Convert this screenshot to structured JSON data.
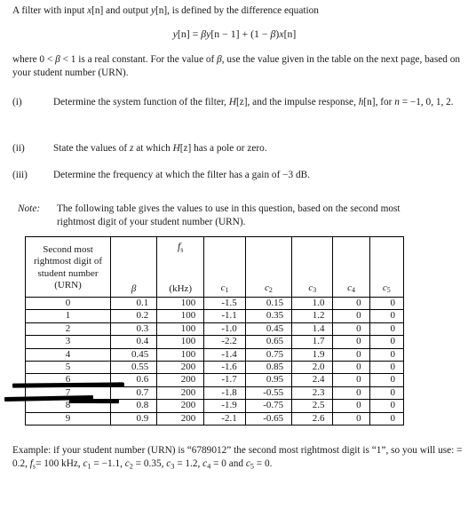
{
  "document": {
    "intro": {
      "line_prefix": "A filter with input ",
      "input_sym": "x",
      "input_idx": "[n]",
      "mid": " and output ",
      "output_sym": "y",
      "output_idx": "[n]",
      "suffix": ", is defined by the difference equation"
    },
    "equation": {
      "lhs_sym": "y",
      "lhs_idx": "[n]",
      "eq": " = ",
      "beta1": "β",
      "t1_sym": "y",
      "t1_idx": "[n − 1]",
      "plus": " + (1 − ",
      "beta2": "β",
      "close": ")",
      "t2_sym": "x",
      "t2_idx": "[n]"
    },
    "where_paragraph": {
      "p1": "where 0 < ",
      "beta": "β",
      "p2": " < 1 is a real constant. For the value of ",
      "beta2": "β",
      "p3": ", use the value given in the table on the next page, based on your student number (URN)."
    },
    "items": [
      {
        "number": "(i)",
        "text_a": "Determine the system function of the filter, ",
        "sym_h": "H",
        "sym_h_idx": "[z]",
        "text_b": ", and the impulse response, ",
        "sym_h2": "h",
        "sym_h2_idx": "[n]",
        "text_c": ", for ",
        "sym_n": "n",
        "text_d": " = −1, 0, 1, 2."
      },
      {
        "number": "(ii)",
        "text_a": "State the values of ",
        "sym_z": "z",
        "text_b": " at which ",
        "sym_h": "H",
        "sym_h_idx": "[z]",
        "text_c": " has a pole or zero."
      },
      {
        "number": "(iii)",
        "text_a": "Determine the frequency at which the filter has a gain of −3 dB."
      }
    ],
    "note": {
      "label": "Note:",
      "text": "The following table gives the values to use in this question, based on the second most rightmost digit of your student number (URN)."
    },
    "table": {
      "headers": {
        "digit": "Second most rightmost digit of student number (URN)",
        "beta": "β",
        "fs_top": "f",
        "fs_sub": "s",
        "fs_unit": "(kHz)",
        "c1": "c",
        "c1_sub": "1",
        "c2": "c",
        "c2_sub": "2",
        "c3": "c",
        "c3_sub": "3",
        "c4": "c",
        "c4_sub": "4",
        "c5": "c",
        "c5_sub": "5"
      },
      "rows": [
        {
          "digit": "0",
          "beta": "0.1",
          "fs": "100",
          "c1": "-1.5",
          "c2": "0.15",
          "c3": "1.0",
          "c4": "0",
          "c5": "0"
        },
        {
          "digit": "1",
          "beta": "0.2",
          "fs": "100",
          "c1": "-1.1",
          "c2": "0.35",
          "c3": "1.2",
          "c4": "0",
          "c5": "0"
        },
        {
          "digit": "2",
          "beta": "0.3",
          "fs": "100",
          "c1": "-1.0",
          "c2": "0.45",
          "c3": "1.4",
          "c4": "0",
          "c5": "0"
        },
        {
          "digit": "3",
          "beta": "0.4",
          "fs": "100",
          "c1": "-2.2",
          "c2": "0.65",
          "c3": "1.7",
          "c4": "0",
          "c5": "0"
        },
        {
          "digit": "4",
          "beta": "0.45",
          "fs": "100",
          "c1": "-1.4",
          "c2": "0.75",
          "c3": "1.9",
          "c4": "0",
          "c5": "0"
        },
        {
          "digit": "5",
          "beta": "0.55",
          "fs": "200",
          "c1": "-1.6",
          "c2": "0.85",
          "c3": "2.0",
          "c4": "0",
          "c5": "0"
        },
        {
          "digit": "6",
          "beta": "0.6",
          "fs": "200",
          "c1": "-1.7",
          "c2": "0.95",
          "c3": "2.4",
          "c4": "0",
          "c5": "0"
        },
        {
          "digit": "7",
          "beta": "0.7",
          "fs": "200",
          "c1": "-1.8",
          "c2": "-0.55",
          "c3": "2.3",
          "c4": "0",
          "c5": "0"
        },
        {
          "digit": "8",
          "beta": "0.8",
          "fs": "200",
          "c1": "-1.9",
          "c2": "-0.75",
          "c3": "2.5",
          "c4": "0",
          "c5": "0"
        },
        {
          "digit": "9",
          "beta": "0.9",
          "fs": "200",
          "c1": "-2.1",
          "c2": "-0.65",
          "c3": "2.6",
          "c4": "0",
          "c5": "0"
        }
      ]
    },
    "annotations": [
      {
        "name": "pen-strikethrough-row-6",
        "color": "#000000"
      },
      {
        "name": "pen-strikethrough-row-7",
        "color": "#000000"
      }
    ],
    "example": {
      "l1_a": "Example: if your student number (URN) is “6789012” the second most rightmost digit",
      "l2_a": "is “1”, so you will use:  = 0.2, ",
      "fs_sym": "f",
      "fs_sub": "s",
      "l2_b": "= 100 kHz, ",
      "c1_sym": "c",
      "c1_sub": "1",
      "l2_c": " = −1.1,  ",
      "c2_sym": "c",
      "c2_sub": "2",
      "l2_d": " = 0.35,  ",
      "c3_sym": "c",
      "c3_sub": "3",
      "l2_e": " = 1.2,  ",
      "c4_sym": "c",
      "c4_sub": "4",
      "l2_f": " = 0",
      "l3_a": "and  ",
      "c5_sym": "c",
      "c5_sub": "5",
      "l3_b": " = 0."
    }
  }
}
